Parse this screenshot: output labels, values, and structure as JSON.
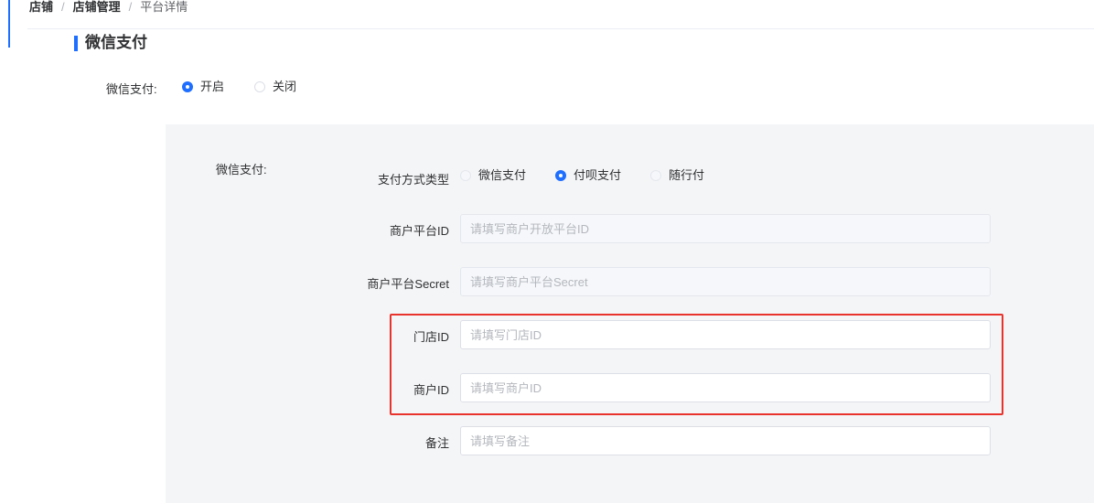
{
  "breadcrumb": {
    "items": [
      "店铺",
      "店铺管理"
    ],
    "separator": "/",
    "current": "平台详情"
  },
  "section": {
    "title": "微信支付"
  },
  "wechat_pay_toggle": {
    "label": "微信支付:",
    "options": [
      {
        "label": "开启",
        "checked": true
      },
      {
        "label": "关闭",
        "checked": false
      }
    ]
  },
  "config": {
    "group_label": "微信支付:",
    "pay_type": {
      "label": "支付方式类型",
      "options": [
        {
          "label": "微信支付",
          "checked": false
        },
        {
          "label": "付呗支付",
          "checked": true
        },
        {
          "label": "随行付",
          "checked": false
        }
      ]
    },
    "fields": {
      "merchant_platform_id": {
        "label": "商户平台ID",
        "placeholder": "请填写商户开放平台ID",
        "value": "",
        "disabled": true
      },
      "merchant_platform_secret": {
        "label": "商户平台Secret",
        "placeholder": "请填写商户平台Secret",
        "value": "",
        "disabled": true
      },
      "store_id": {
        "label": "门店ID",
        "placeholder": "请填写门店ID",
        "value": ""
      },
      "merchant_id": {
        "label": "商户ID",
        "placeholder": "请填写商户ID",
        "value": ""
      },
      "remark": {
        "label": "备注",
        "placeholder": "请填写备注",
        "value": ""
      }
    }
  },
  "colors": {
    "accent": "#1e6fff",
    "highlight_border": "#e8332d",
    "inner_panel_bg": "#f4f5f7"
  }
}
